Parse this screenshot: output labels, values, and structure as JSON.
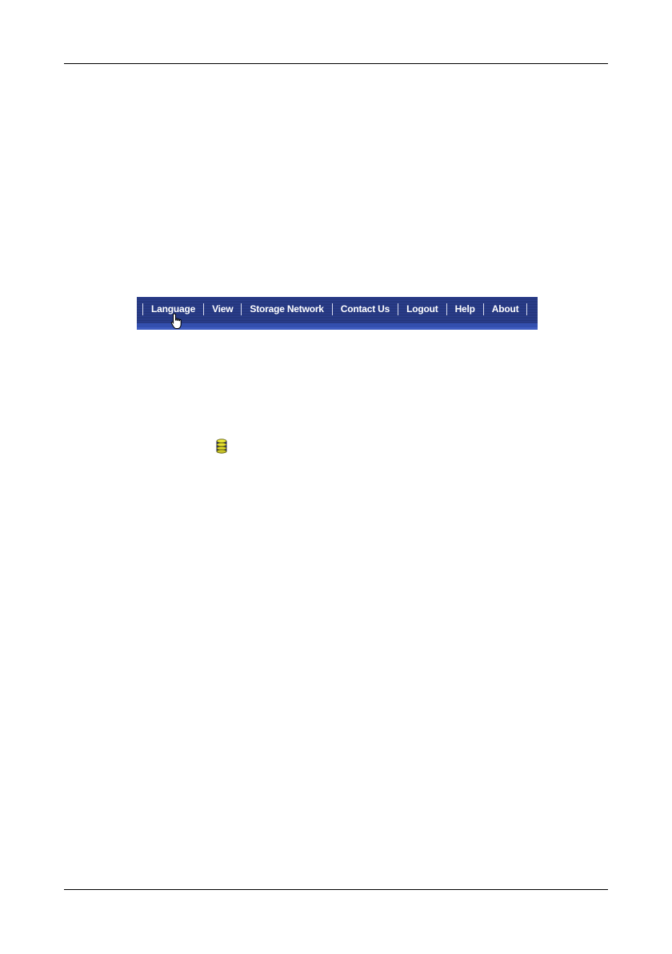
{
  "menu": {
    "items": [
      {
        "label": "Language"
      },
      {
        "label": "View"
      },
      {
        "label": "Storage Network"
      },
      {
        "label": "Contact Us"
      },
      {
        "label": "Logout"
      },
      {
        "label": "Help"
      },
      {
        "label": "About"
      }
    ],
    "bar_color": "#223478",
    "text_color": "#ffffff"
  },
  "icons": {
    "cursor": "hand-pointer-icon",
    "storage": "database-icon"
  }
}
